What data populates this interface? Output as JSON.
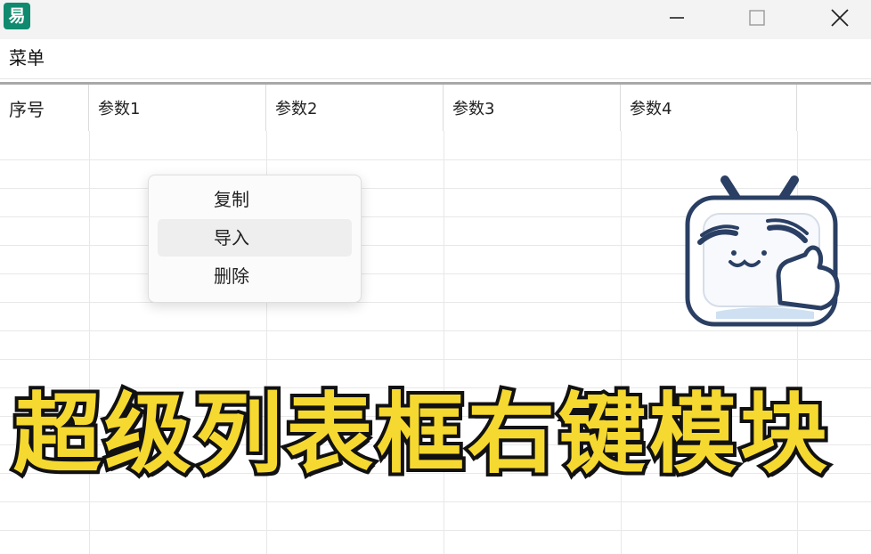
{
  "window": {
    "app_icon_glyph": "易",
    "minimize_icon": "minimize-icon",
    "maximize_icon": "maximize-icon",
    "close_icon": "close-icon"
  },
  "menubar": {
    "menu_label": "菜单"
  },
  "listview": {
    "columns": [
      "序号",
      "参数1",
      "参数2",
      "参数3",
      "参数4"
    ]
  },
  "context_menu": {
    "items": [
      "复制",
      "导入",
      "删除"
    ],
    "highlighted_index": 1
  },
  "overlay": {
    "caption": "超级列表框右键模块"
  },
  "colors": {
    "caption_fill": "#f6d930",
    "caption_stroke": "#111111",
    "app_icon": "#0f8a6e"
  }
}
